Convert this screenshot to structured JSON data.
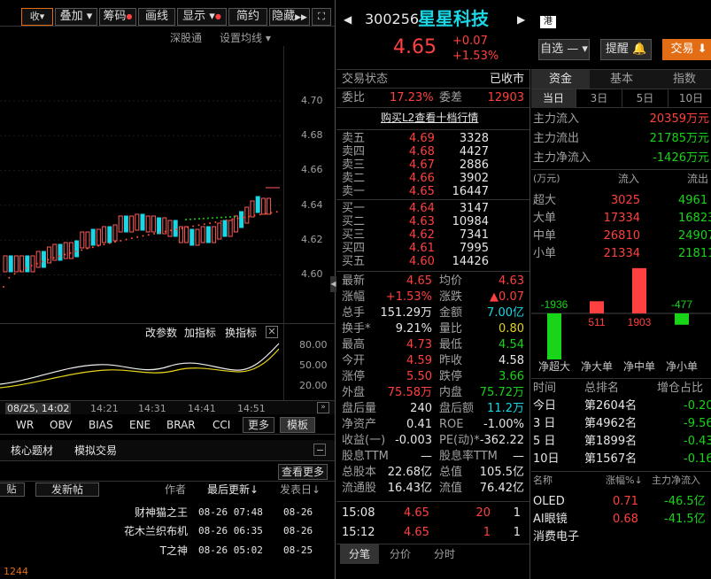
{
  "toolbar": {
    "items": [
      "叠加",
      "筹码",
      "画线",
      "显示",
      "简约",
      "隐藏"
    ],
    "sub_items": [
      "深股通",
      "设置均线"
    ]
  },
  "price_axis": [
    "4.70",
    "4.68",
    "4.66",
    "4.64",
    "4.62",
    "4.60"
  ],
  "indicator": {
    "buttons": [
      "改参数",
      "加指标",
      "换指标"
    ],
    "axis": [
      "80.00",
      "50.00",
      "20.00"
    ]
  },
  "time_axis": [
    "08/25, 14:02",
    "14:21",
    "14:31",
    "14:41",
    "14:51"
  ],
  "indicator_tabs": [
    "WR",
    "OBV",
    "BIAS",
    "ENE",
    "BRAR",
    "CCI",
    "更多",
    "模板"
  ],
  "news": {
    "tabs": [
      "核心题材",
      "模拟交易"
    ],
    "view_more": "查看更多",
    "header": {
      "post": "发新帖",
      "author": "作者",
      "last_update": "最后更新↓",
      "post_date": "发表日↓"
    },
    "rows": [
      {
        "author": "财神猫之王",
        "updated": "08-26 07:48",
        "date": "08-26"
      },
      {
        "author": "花木兰织布机",
        "updated": "08-26 06:35",
        "date": "08-26"
      },
      {
        "author": "T之神",
        "updated": "08-26 05:02",
        "date": "08-25"
      }
    ]
  },
  "stock": {
    "code": "300256",
    "name": "星星科技",
    "market_badge": "港",
    "price": "4.65",
    "change": "+0.07",
    "change_pct": "+1.53%",
    "watchlist": "自选",
    "alert": "提醒",
    "trade": "交易"
  },
  "status": {
    "label": "交易状态",
    "value": "已收市"
  },
  "ratio": {
    "label1": "委比",
    "value1": "17.23%",
    "label2": "委差",
    "value2": "12903"
  },
  "level2_link": "购买L2查看十档行情",
  "sell": [
    {
      "label": "卖五",
      "price": "4.69",
      "vol": "3328"
    },
    {
      "label": "卖四",
      "price": "4.68",
      "vol": "4427"
    },
    {
      "label": "卖三",
      "price": "4.67",
      "vol": "2886"
    },
    {
      "label": "卖二",
      "price": "4.66",
      "vol": "3902"
    },
    {
      "label": "卖一",
      "price": "4.65",
      "vol": "16447"
    }
  ],
  "buy": [
    {
      "label": "买一",
      "price": "4.64",
      "vol": "3147"
    },
    {
      "label": "买二",
      "price": "4.63",
      "vol": "10984"
    },
    {
      "label": "买三",
      "price": "4.62",
      "vol": "7341"
    },
    {
      "label": "买四",
      "price": "4.61",
      "vol": "7995"
    },
    {
      "label": "买五",
      "price": "4.60",
      "vol": "14426"
    }
  ],
  "stats": [
    {
      "l1": "最新",
      "v1": "4.65",
      "c1": "red",
      "l2": "均价",
      "v2": "4.63",
      "c2": "red"
    },
    {
      "l1": "涨幅",
      "v1": "+1.53%",
      "c1": "red",
      "l2": "涨跌",
      "v2": "▲0.07",
      "c2": "red"
    },
    {
      "l1": "总手",
      "v1": "151.29万",
      "c1": "white",
      "l2": "金额",
      "v2": "7.00亿",
      "c2": "cyan"
    },
    {
      "l1": "换手*",
      "v1": "9.21%",
      "c1": "white",
      "l2": "量比",
      "v2": "0.80",
      "c2": "yellow"
    },
    {
      "l1": "最高",
      "v1": "4.73",
      "c1": "red",
      "l2": "最低",
      "v2": "4.54",
      "c2": "green"
    },
    {
      "l1": "今开",
      "v1": "4.59",
      "c1": "red",
      "l2": "昨收",
      "v2": "4.58",
      "c2": "white"
    },
    {
      "l1": "涨停",
      "v1": "5.50",
      "c1": "red",
      "l2": "跌停",
      "v2": "3.66",
      "c2": "green"
    },
    {
      "l1": "外盘",
      "v1": "75.58万",
      "c1": "red",
      "l2": "内盘",
      "v2": "75.72万",
      "c2": "green"
    },
    {
      "l1": "盘后量",
      "v1": "240",
      "c1": "white",
      "l2": "盘后额",
      "v2": "11.2万",
      "c2": "cyan"
    },
    {
      "l1": "净资产",
      "v1": "0.41",
      "c1": "white",
      "l2": "ROE",
      "v2": "-1.00%",
      "c2": "white"
    },
    {
      "l1": "收益(一)",
      "v1": "-0.003",
      "c1": "white",
      "l2": "PE(动)*",
      "v2": "-362.22",
      "c2": "white"
    },
    {
      "l1": "股息TTM",
      "v1": "—",
      "c1": "white",
      "l2": "股息率TTM",
      "v2": "—",
      "c2": "white"
    },
    {
      "l1": "总股本",
      "v1": "22.68亿",
      "c1": "white",
      "l2": "总值",
      "v2": "105.5亿",
      "c2": "white"
    },
    {
      "l1": "流通股",
      "v1": "16.43亿",
      "c1": "white",
      "l2": "流值",
      "v2": "76.42亿",
      "c2": "white"
    }
  ],
  "ticks": [
    {
      "time": "15:08",
      "price": "4.65",
      "vol": "20",
      "n": "1"
    },
    {
      "time": "15:12",
      "price": "4.65",
      "vol": "1",
      "n": "1"
    }
  ],
  "bottom_tabs": [
    "分笔",
    "分价",
    "分时"
  ],
  "fund": {
    "tabs": [
      "资金",
      "基本",
      "指数"
    ],
    "periods": [
      "当日",
      "3日",
      "5日",
      "10日"
    ],
    "flows": [
      {
        "label": "主力流入",
        "value": "20359万元",
        "color": "red"
      },
      {
        "label": "主力流出",
        "value": "21785万元",
        "color": "green"
      },
      {
        "label": "主力净流入",
        "value": "-1426万元",
        "color": "green"
      }
    ],
    "table_header": {
      "unit": "(万元)",
      "in": "流入",
      "out": "流出"
    },
    "table": [
      {
        "label": "超大",
        "in": "3025",
        "out": "4961"
      },
      {
        "label": "大单",
        "in": "17334",
        "out": "16823"
      },
      {
        "label": "中单",
        "in": "26810",
        "out": "24907"
      },
      {
        "label": "小单",
        "in": "21334",
        "out": "21811"
      }
    ],
    "bars": [
      {
        "label": "净超大",
        "value": -1936,
        "text": "-1936"
      },
      {
        "label": "净大单",
        "value": 511,
        "text": "511"
      },
      {
        "label": "净中单",
        "value": 1903,
        "text": "1903"
      },
      {
        "label": "净小单",
        "value": -477,
        "text": "-477"
      }
    ],
    "rank_header": {
      "time": "时间",
      "rank": "总排名",
      "change": "增仓占比"
    },
    "ranks": [
      {
        "period": "今日",
        "rank": "第2604名",
        "change": "-0.20%"
      },
      {
        "period": "3 日",
        "rank": "第4962名",
        "change": "-9.56%"
      },
      {
        "period": "5 日",
        "rank": "第1899名",
        "change": "-0.43%"
      },
      {
        "period": "10日",
        "rank": "第1567名",
        "change": "-0.16%"
      }
    ],
    "sector_header": {
      "name": "名称",
      "pct": "涨幅%↓",
      "net": "主力净流入"
    },
    "sectors": [
      {
        "name": "OLED",
        "pct": "0.71",
        "net": "-46.5亿"
      },
      {
        "name": "AI眼镜",
        "pct": "0.68",
        "net": "-41.5亿"
      },
      {
        "name": "消费电子",
        "pct": "",
        "net": ""
      }
    ]
  },
  "footer": {
    "left": "1244"
  },
  "colors": {
    "up": "#ff4040",
    "down": "#19d419",
    "accent": "#e36d14",
    "cyan": "#1ad7e6",
    "ma": "#ff5030"
  }
}
